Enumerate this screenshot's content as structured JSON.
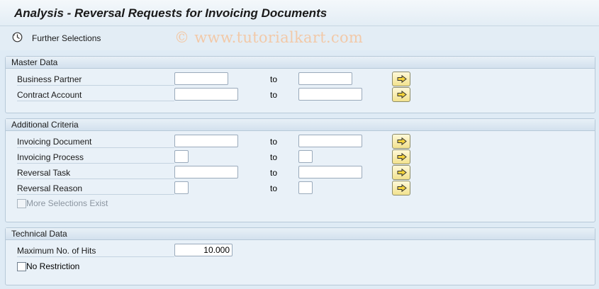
{
  "window": {
    "title": "Analysis - Reversal Requests for Invoicing Documents"
  },
  "toolbar": {
    "further_selections_label": "Further Selections",
    "icon": "clock-icon"
  },
  "watermark": "© www.tutorialkart.com",
  "to_label": "to",
  "master_data": {
    "title": "Master Data",
    "fields": [
      {
        "label": "Business Partner",
        "from": "",
        "to": ""
      },
      {
        "label": "Contract Account",
        "from": "",
        "to": ""
      }
    ]
  },
  "additional_criteria": {
    "title": "Additional Criteria",
    "fields": [
      {
        "label": "Invoicing Document",
        "from": "",
        "to": ""
      },
      {
        "label": "Invoicing Process",
        "from": "",
        "to": ""
      },
      {
        "label": "Reversal Task",
        "from": "",
        "to": ""
      },
      {
        "label": "Reversal Reason",
        "from": "",
        "to": ""
      }
    ],
    "more_selections_label": "More Selections Exist"
  },
  "technical_data": {
    "title": "Technical Data",
    "max_hits_label": "Maximum No. of Hits",
    "max_hits_value": "10.000",
    "no_restriction_label": "No Restriction"
  },
  "colors": {
    "background": "#dfebf5",
    "group_background": "#e9f1f8",
    "multi_select_button": "#f2e28e"
  }
}
